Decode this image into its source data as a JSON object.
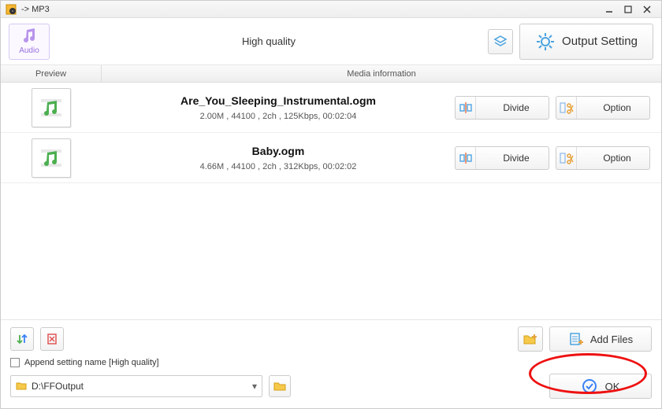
{
  "window": {
    "title": "-> MP3",
    "minimize": "_",
    "maximize": "▢",
    "close": "✕"
  },
  "topbar": {
    "audio_label": "Audio",
    "quality_label": "High quality",
    "output_setting_label": "Output Setting"
  },
  "columns": {
    "preview": "Preview",
    "media": "Media information"
  },
  "files": [
    {
      "name": "Are_You_Sleeping_Instrumental.ogm",
      "meta": "2.00M , 44100 , 2ch , 125Kbps, 00:02:04",
      "divide": "Divide",
      "option": "Option"
    },
    {
      "name": "Baby.ogm",
      "meta": "4.66M , 44100 , 2ch , 312Kbps, 00:02:02",
      "divide": "Divide",
      "option": "Option"
    }
  ],
  "bottom": {
    "append_label": "Append setting name [High quality]",
    "add_files": "Add Files",
    "output_path": "D:\\FFOutput",
    "ok_label": "OK"
  }
}
